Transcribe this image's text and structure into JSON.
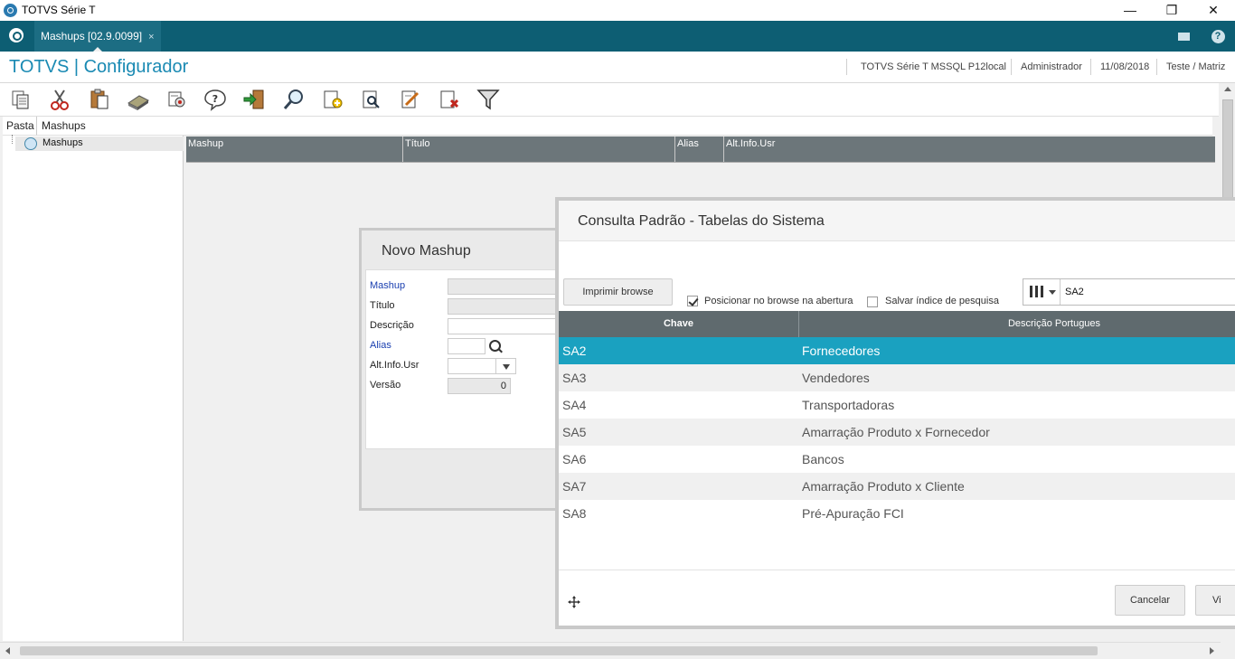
{
  "window": {
    "title": "TOTVS Série T"
  },
  "topbar": {
    "tab_label": "Mashups [02.9.0099]",
    "tab_close": "×"
  },
  "header": {
    "app_title": "TOTVS | Configurador",
    "environment": "TOTVS Série T  MSSQL P12local",
    "user": "Administrador",
    "date": "11/08/2018",
    "company": "Teste / Matriz"
  },
  "toolbar": {
    "icons": [
      "copy-icon",
      "cut-icon",
      "paste-icon",
      "calculator-icon",
      "settings-icon",
      "help-icon",
      "exit-icon",
      "search-icon",
      "add-icon",
      "preview-icon",
      "edit-icon",
      "delete-icon",
      "filter-icon"
    ]
  },
  "tree": {
    "header": "Pasta",
    "node_label": "Mashups"
  },
  "main": {
    "header": "Mashups",
    "columns": [
      "Mashup",
      "Título",
      "Alias",
      "Alt.Info.Usr"
    ]
  },
  "novo_mashup": {
    "title": "Novo Mashup",
    "fields": {
      "mashup": "Mashup",
      "titulo": "Título",
      "descricao": "Descrição",
      "alias": "Alias",
      "alt_info_usr": "Alt.Info.Usr",
      "versao": "Versão"
    },
    "versao_value": "0"
  },
  "consulta": {
    "title": "Consulta Padrão - Tabelas do Sistema",
    "print_button": "Imprimir browse",
    "position_checkbox": "Posicionar no browse na abertura",
    "position_checked": true,
    "save_index_checkbox": "Salvar índice de pesquisa",
    "save_index_checked": false,
    "search_value": "SA2",
    "columns": [
      "Chave",
      "Descrição Portugues"
    ],
    "rows": [
      {
        "key": "SA2",
        "desc": "Fornecedores",
        "selected": true
      },
      {
        "key": "SA3",
        "desc": "Vendedores"
      },
      {
        "key": "SA4",
        "desc": "Transportadoras"
      },
      {
        "key": "SA5",
        "desc": "Amarração Produto x Fornecedor"
      },
      {
        "key": "SA6",
        "desc": "Bancos"
      },
      {
        "key": "SA7",
        "desc": "Amarração Produto x Cliente"
      },
      {
        "key": "SA8",
        "desc": "Pré-Apuração FCI"
      }
    ],
    "cancel_button": "Cancelar",
    "view_button": "Vi"
  },
  "colors": {
    "accent": "#0d5e73",
    "selection": "#1aa1c0",
    "title_blue": "#1a8ab3"
  }
}
